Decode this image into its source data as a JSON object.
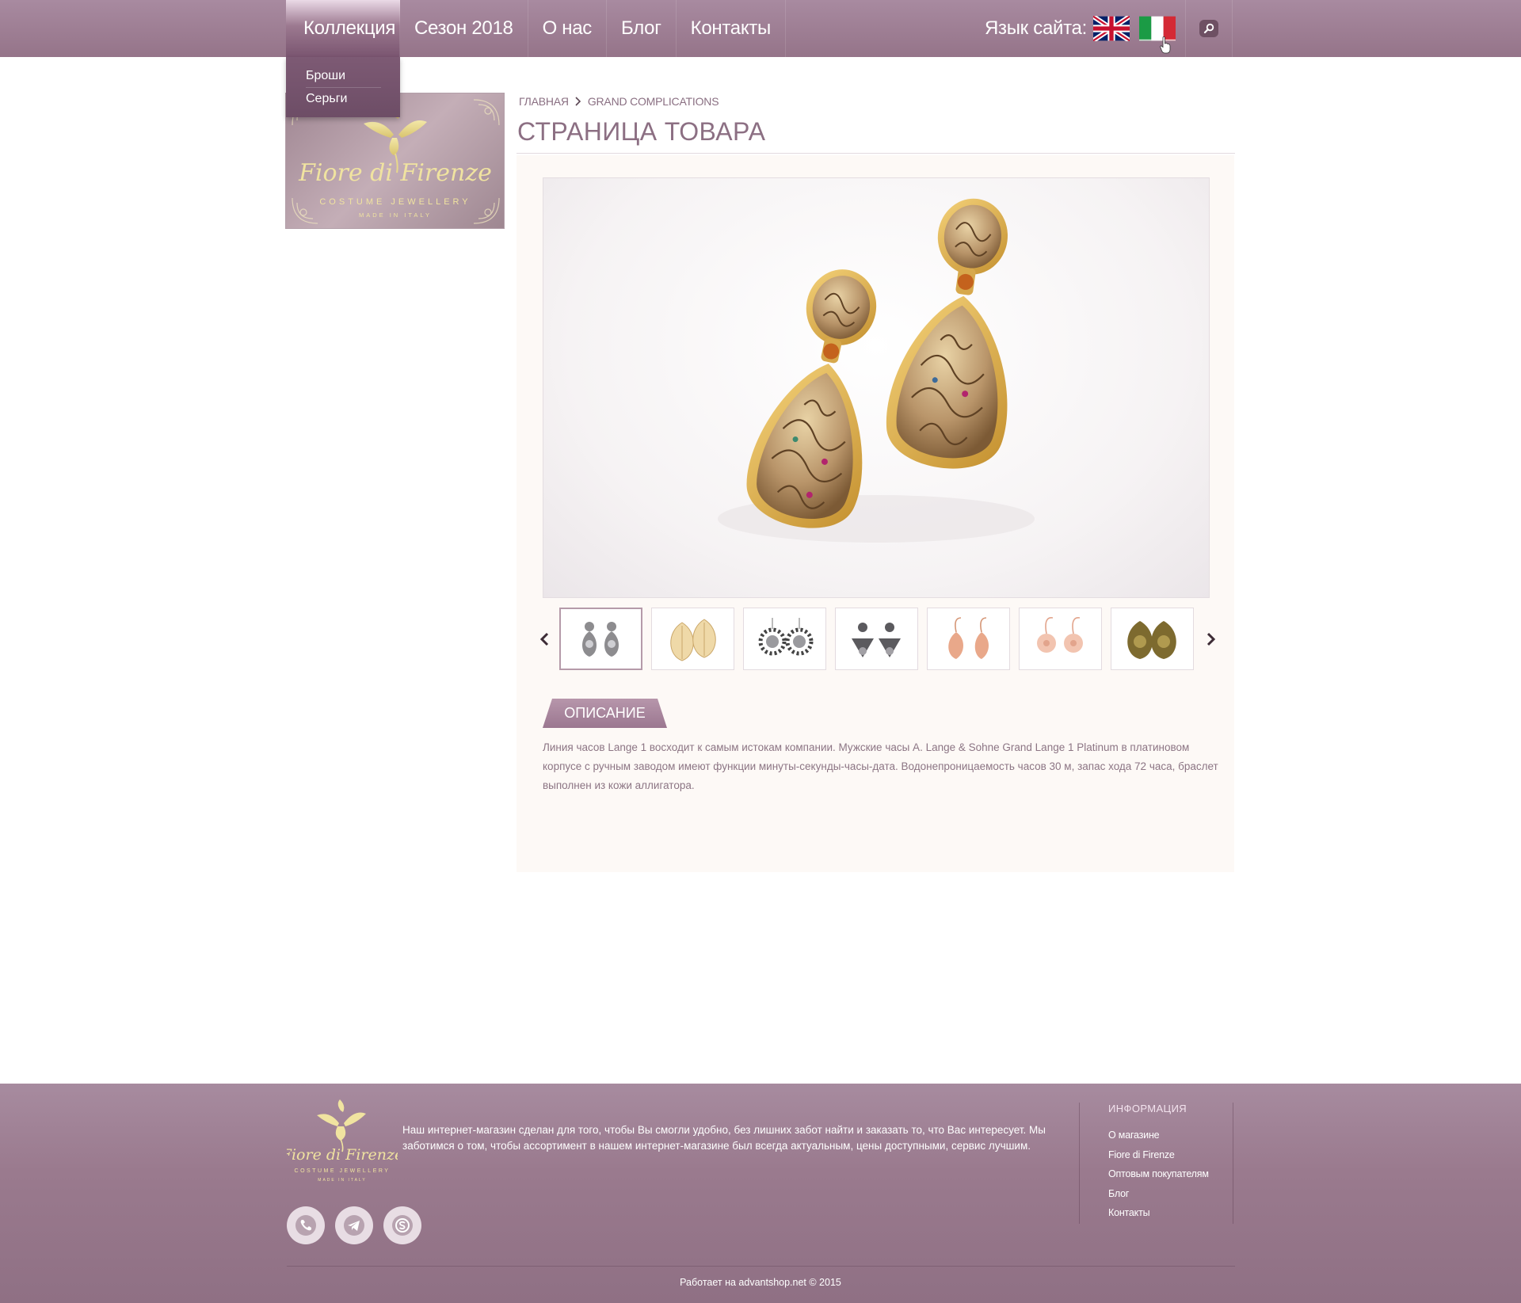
{
  "nav": {
    "items": [
      {
        "label": "Коллекция",
        "active": true
      },
      {
        "label": "Сезон 2018",
        "active": false
      },
      {
        "label": "О нас",
        "active": false
      },
      {
        "label": "Блог",
        "active": false
      },
      {
        "label": "Контакты",
        "active": false
      }
    ],
    "dropdown": [
      "Броши",
      "Серьги"
    ],
    "language_label": "Язык сайта:",
    "flags": [
      "uk-flag-icon",
      "italy-flag-icon"
    ]
  },
  "logo": {
    "brand": "Fiore di Firenze",
    "tagline": "COSTUME JEWELLERY",
    "subtag": "MADE IN ITALY"
  },
  "breadcrumb": [
    "ГЛАВНАЯ",
    "GRAND COMPLICATIONS"
  ],
  "page_title": "СТРАНИЦА ТОВАРА",
  "gallery": {
    "main_image": "gold-filigree-teardrop-earrings-image",
    "thumbnails": [
      {
        "name": "silver-filigree-earrings-thumb",
        "selected": true
      },
      {
        "name": "gold-leaf-earrings-thumb",
        "selected": false
      },
      {
        "name": "silver-sun-earrings-thumb",
        "selected": false
      },
      {
        "name": "silver-fan-earrings-thumb",
        "selected": false
      },
      {
        "name": "rose-gold-leaf-earrings-thumb",
        "selected": false
      },
      {
        "name": "rose-gold-flower-earrings-thumb",
        "selected": false
      },
      {
        "name": "bronze-ornate-earrings-thumb",
        "selected": false
      }
    ]
  },
  "tabs": {
    "description_label": "ОПИСАНИЕ"
  },
  "description": "Линия часов Lange 1 восходит к самым истокам компании. Мужские часы A. Lange & Sohne Grand Lange 1 Platinum в платиновом корпусе с ручным заводом имеют функции минуты-секунды-часы-дата. Водонепроницаемость часов 30 м, запас хода 72 часа, браслет выполнен из кожи аллигатора.",
  "footer": {
    "about_text": "Наш интернет-магазин сделан для того, чтобы Вы смогли удобно, без лишних забот найти и заказать то, что Вас интересует. Мы заботимся о том, чтобы ассортимент в нашем интернет-магазине был всегда актуальным, цены доступными, сервис лучшим.",
    "social": [
      "viber-icon",
      "telegram-icon",
      "skype-icon"
    ],
    "info_title": "ИНФОРМАЦИЯ",
    "info_links": [
      "О магазине",
      "Fiore di Firenze",
      "Оптовым покупателям",
      "Блог",
      "Контакты"
    ],
    "copyright": "Работает на advantshop.net © 2015"
  },
  "colors": {
    "header": "#9d7d92",
    "accent": "#8c6f83",
    "panel": "#fdf9f6",
    "gold": "#e8d98a"
  }
}
